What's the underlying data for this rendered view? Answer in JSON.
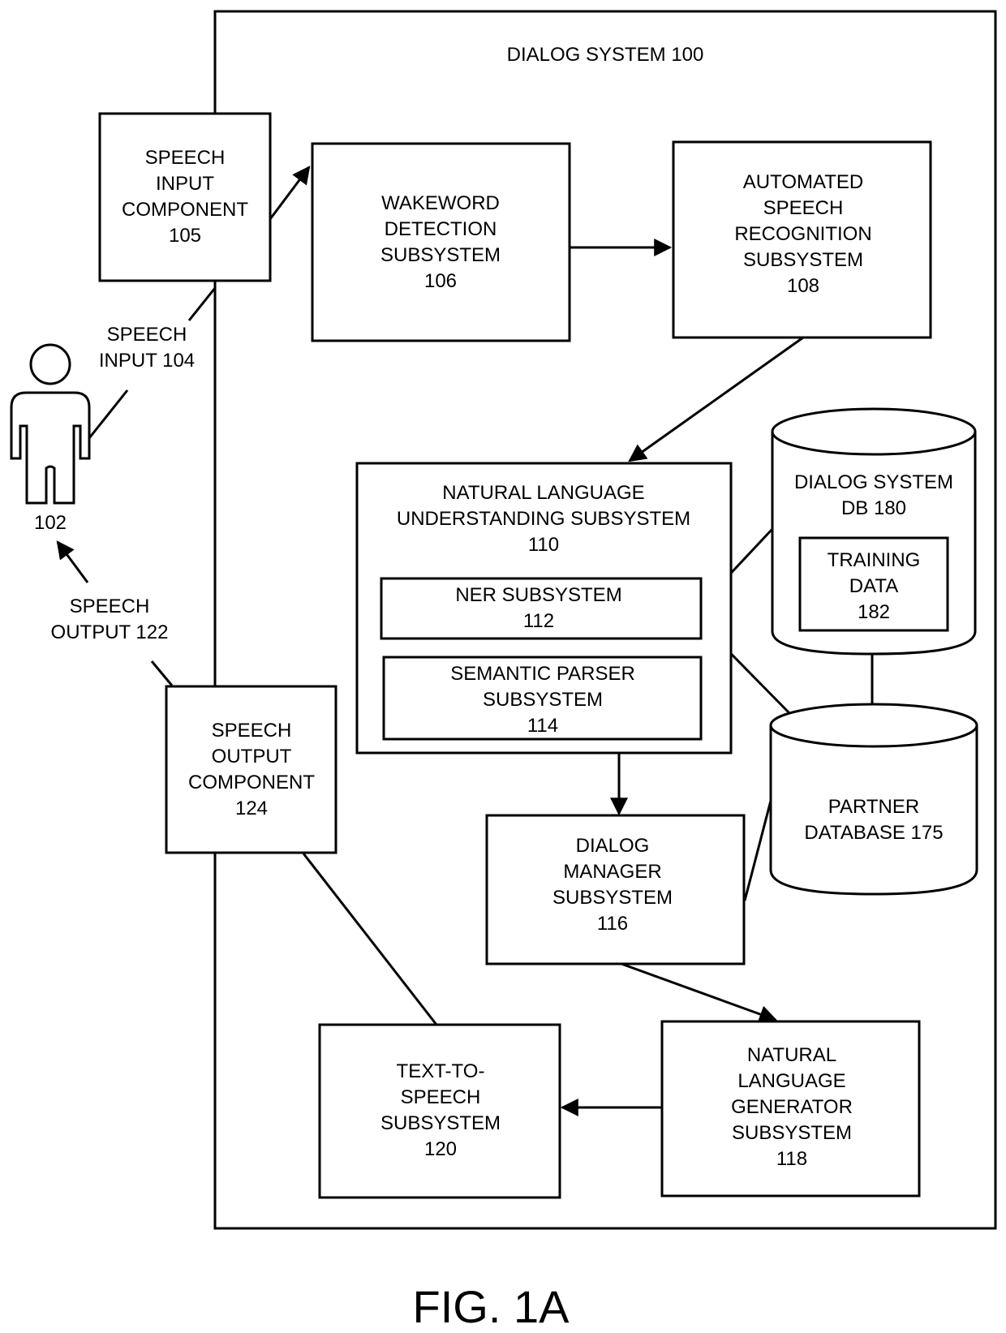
{
  "title": "DIALOG SYSTEM 100",
  "figure_label": "FIG. 1A",
  "colors": {
    "stroke": "#000000",
    "background": "#ffffff"
  },
  "user": {
    "icon": "person-icon",
    "label": "102"
  },
  "labels": {
    "speech_input": [
      "SPEECH",
      "INPUT 104"
    ],
    "speech_output": [
      "SPEECH",
      "OUTPUT 122"
    ]
  },
  "nodes": {
    "speech_input_component": [
      "SPEECH",
      "INPUT",
      "COMPONENT",
      "105"
    ],
    "wakeword": [
      "WAKEWORD",
      "DETECTION",
      "SUBSYSTEM",
      "106"
    ],
    "asr": [
      "AUTOMATED",
      "SPEECH",
      "RECOGNITION",
      "SUBSYSTEM",
      "108"
    ],
    "nlu": [
      "NATURAL LANGUAGE",
      "UNDERSTANDING SUBSYSTEM",
      "110"
    ],
    "ner": [
      "NER SUBSYSTEM",
      "112"
    ],
    "semantic_parser": [
      "SEMANTIC PARSER",
      "SUBSYSTEM",
      "114"
    ],
    "dialog_db": [
      "DIALOG SYSTEM",
      "DB 180"
    ],
    "training_data": [
      "TRAINING",
      "DATA",
      "182"
    ],
    "partner_db": [
      "PARTNER",
      "DATABASE 175"
    ],
    "dialog_manager": [
      "DIALOG",
      "MANAGER",
      "SUBSYSTEM",
      "116"
    ],
    "speech_output_component": [
      "SPEECH",
      "OUTPUT",
      "COMPONENT",
      "124"
    ],
    "nlg": [
      "NATURAL",
      "LANGUAGE",
      "GENERATOR",
      "SUBSYSTEM",
      "118"
    ],
    "tts": [
      "TEXT-TO-",
      "SPEECH",
      "SUBSYSTEM",
      "120"
    ]
  },
  "edges": [
    {
      "from": "speech_input_component",
      "to": "wakeword",
      "arrow": true
    },
    {
      "from": "wakeword",
      "to": "asr",
      "arrow": true
    },
    {
      "from": "asr",
      "to": "nlu",
      "arrow": true
    },
    {
      "from": "nlu",
      "to": "dialog_manager",
      "arrow": true
    },
    {
      "from": "dialog_manager",
      "to": "nlg",
      "arrow": true
    },
    {
      "from": "nlg",
      "to": "tts",
      "arrow": true
    },
    {
      "from": "tts",
      "to": "speech_output_component",
      "arrow": false
    },
    {
      "from": "ner",
      "to": "dialog_db",
      "arrow": false
    },
    {
      "from": "ner",
      "to": "partner_db",
      "arrow": false
    },
    {
      "from": "dialog_db",
      "to": "partner_db",
      "arrow": false
    },
    {
      "from": "dialog_manager",
      "to": "partner_db",
      "arrow": false
    },
    {
      "from": "user",
      "to": "speech_input_component",
      "arrow": false
    },
    {
      "from": "speech_output_component",
      "to": "user",
      "arrow": true
    }
  ]
}
